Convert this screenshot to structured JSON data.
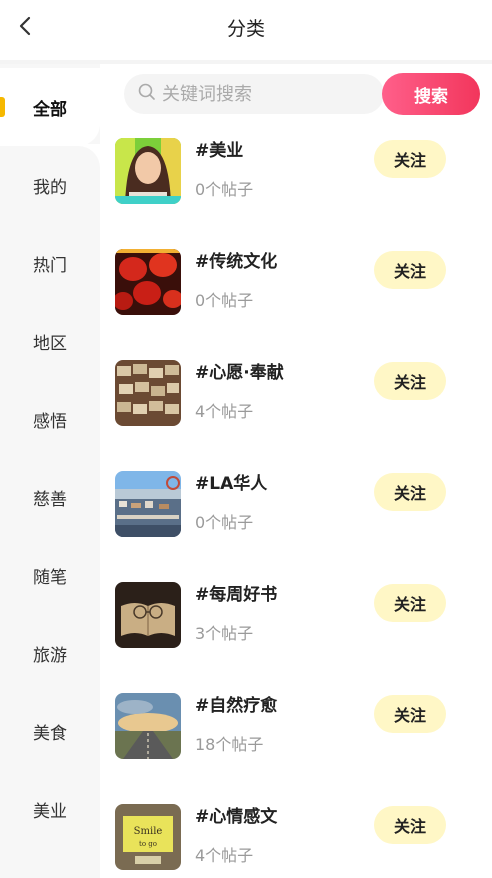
{
  "header": {
    "title": "分类",
    "back_icon": "chevron-left-icon"
  },
  "search": {
    "placeholder": "关键词搜索",
    "button_label": "搜索",
    "icon": "search-icon"
  },
  "sidebar": {
    "accent_color": "#f6b800",
    "items": [
      {
        "label": "全部",
        "active": true
      },
      {
        "label": "我的"
      },
      {
        "label": "热门"
      },
      {
        "label": "地区"
      },
      {
        "label": "感悟"
      },
      {
        "label": "慈善"
      },
      {
        "label": "随笔"
      },
      {
        "label": "旅游"
      },
      {
        "label": "美食"
      },
      {
        "label": "美业"
      }
    ]
  },
  "categories": [
    {
      "name": "#美业",
      "count": "0个帖子",
      "follow_label": "关注",
      "thumb": "portrait-photo"
    },
    {
      "name": "#传统文化",
      "count": "0个帖子",
      "follow_label": "关注",
      "thumb": "red-lanterns-photo"
    },
    {
      "name": "#心愿·奉献",
      "count": "4个帖子",
      "follow_label": "关注",
      "thumb": "wish-plaques-photo"
    },
    {
      "name": "#LA华人",
      "count": "0个帖子",
      "follow_label": "关注",
      "thumb": "city-harbor-photo"
    },
    {
      "name": "#每周好书",
      "count": "3个帖子",
      "follow_label": "关注",
      "thumb": "book-glasses-photo"
    },
    {
      "name": "#自然疗愈",
      "count": "18个帖子",
      "follow_label": "关注",
      "thumb": "road-sky-photo"
    },
    {
      "name": "#心情感文",
      "count": "4个帖子",
      "follow_label": "关注",
      "thumb": "smile-note-photo"
    }
  ],
  "colors": {
    "follow_bg": "#fff7c6",
    "search_btn_start": "#ff5f8a",
    "search_btn_end": "#f2365c"
  }
}
